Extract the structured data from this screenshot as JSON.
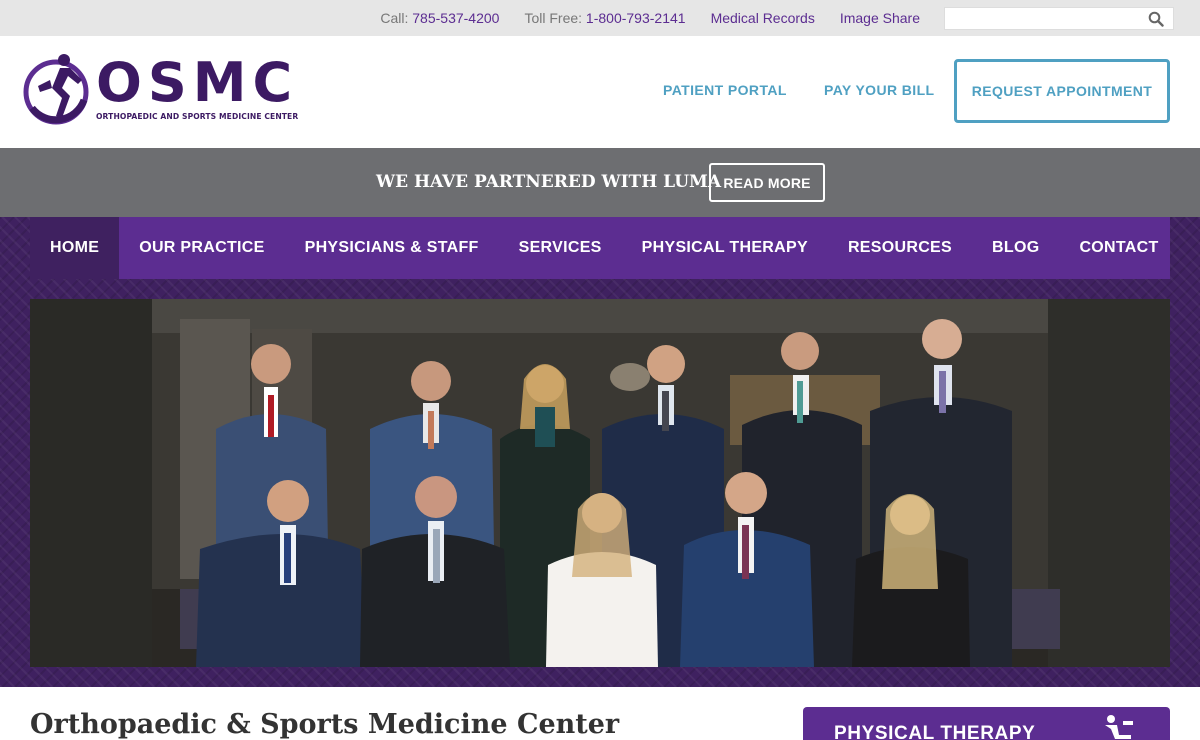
{
  "utility": {
    "call_label": "Call:",
    "call_number": "785-537-4200",
    "tollfree_label": "Toll Free:",
    "tollfree_number": "1-800-793-2141",
    "medical_records": "Medical Records",
    "image_share": "Image Share",
    "search_placeholder": ""
  },
  "header": {
    "logo_text": "OSMC",
    "logo_subtitle": "ORTHOPAEDIC AND SPORTS MEDICINE CENTER",
    "patient_portal": "PATIENT PORTAL",
    "pay_bill": "PAY YOUR BILL",
    "request_appointment": "REQUEST APPOINTMENT"
  },
  "announcement": {
    "message": "WE HAVE PARTNERED WITH LUMA",
    "button": "READ MORE"
  },
  "nav": {
    "items": [
      "HOME",
      "OUR PRACTICE",
      "PHYSICIANS & STAFF",
      "SERVICES",
      "PHYSICAL THERAPY",
      "RESOURCES",
      "BLOG",
      "CONTACT"
    ],
    "active": "HOME"
  },
  "main": {
    "heading": "Orthopaedic & Sports Medicine Center",
    "sidebar_box": "PHYSICAL THERAPY"
  },
  "colors": {
    "brand_purple": "#5c2d91",
    "dark_purple": "#3f2160",
    "accent_blue": "#4fa0c2",
    "announce_gray": "#6d6e71"
  },
  "icons": [
    "search-icon",
    "runner-logo-icon",
    "physical-therapy-icon"
  ]
}
